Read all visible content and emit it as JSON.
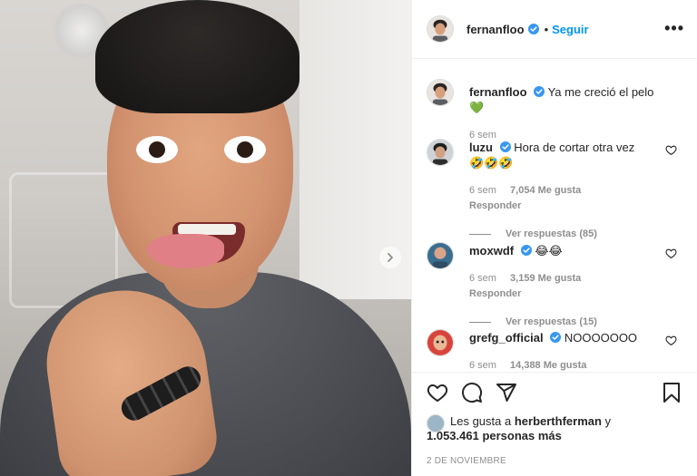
{
  "post": {
    "author": "fernanfloo",
    "separator": "•",
    "follow_label": "Seguir",
    "more_label": "•••",
    "caption": "Ya me creció el pelo",
    "caption_emoji": "💚",
    "caption_time": "6 sem",
    "date": "2 DE NOVIEMBRE"
  },
  "comments": [
    {
      "user": "luzu",
      "text": "Hora de cortar otra vez",
      "text_line2": "🤣🤣🤣",
      "time": "6 sem",
      "likes": "7,054 Me gusta",
      "reply_label": "Responder",
      "view_replies": "Ver respuestas (85)"
    },
    {
      "user": "moxwdf",
      "text": "😂😂",
      "time": "6 sem",
      "likes": "3,159 Me gusta",
      "reply_label": "Responder",
      "view_replies": "Ver respuestas (15)"
    },
    {
      "user": "grefg_official",
      "text": "NOOOOOOO",
      "time": "6 sem",
      "likes": "14,388 Me gusta"
    }
  ],
  "likes_summary": {
    "prefix": "Les gusta a",
    "user": "herberthferman",
    "connector": "y",
    "count_text": "1.053.461 personas más"
  },
  "icons": {
    "like": "heart-icon",
    "comment": "comment-icon",
    "share": "share-icon",
    "save": "bookmark-icon",
    "verified": "verified-badge-icon",
    "next": "chevron-right-icon"
  },
  "colors": {
    "accent": "#0095f6",
    "verified": "#3897f0",
    "caption_heart": "#3ec43a",
    "muted": "#8e8e8e"
  }
}
